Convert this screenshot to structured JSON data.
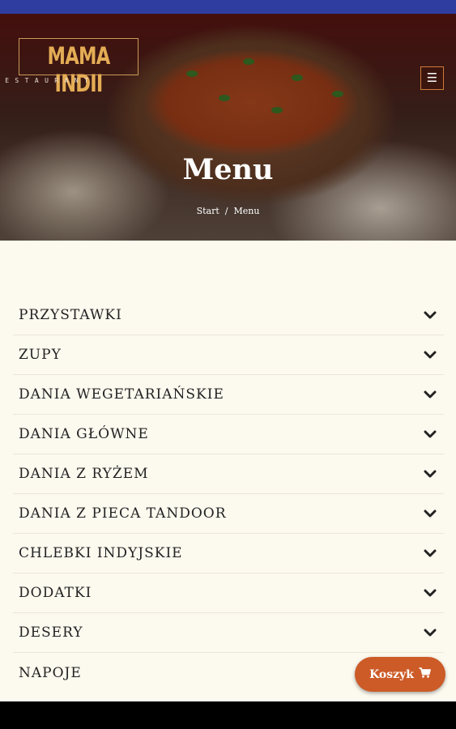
{
  "logo": {
    "main": "MAMA INDII",
    "sub": "RESTAURANT"
  },
  "header": {
    "title": "Menu",
    "breadcrumb": {
      "home": "Start",
      "separator": "/",
      "current": "Menu"
    }
  },
  "menu": {
    "items": [
      {
        "label": "PRZYSTAWKI"
      },
      {
        "label": "ZUPY"
      },
      {
        "label": "DANIA WEGETARIAŃSKIE"
      },
      {
        "label": "DANIA GŁÓWNE"
      },
      {
        "label": "DANIA Z RYŻEM"
      },
      {
        "label": "DANIA Z PIECA TANDOOR"
      },
      {
        "label": "CHLEBKI INDYJSKIE"
      },
      {
        "label": "DODATKI"
      },
      {
        "label": "DESERY"
      },
      {
        "label": "NAPOJE"
      }
    ],
    "expand_icon": "chevron-down-icon"
  },
  "cart": {
    "label": "Koszyk",
    "icon": "cart-icon"
  },
  "toggle": {
    "icon": "hamburger-icon"
  },
  "colors": {
    "status_bar": "#2f3da0",
    "accent": "#cc5b27",
    "background": "#fcf9ef",
    "logo": "#e4ad55"
  }
}
